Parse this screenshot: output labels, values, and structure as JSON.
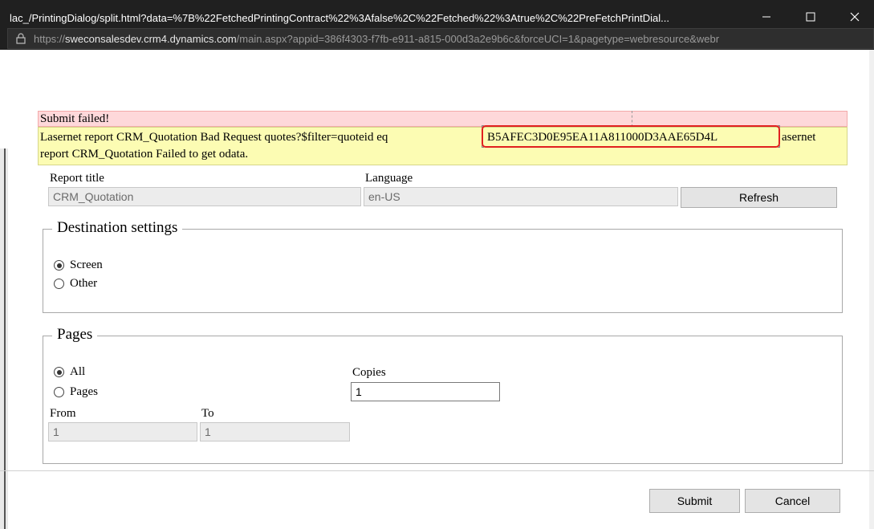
{
  "window": {
    "title": "lac_/PrintingDialog/split.html?data=%7B%22FetchedPrintingContract%22%3Afalse%2C%22Fetched%22%3Atrue%2C%22PreFetchPrintDial...",
    "url_scheme": "https://",
    "url_domain": "sweconsalesdev.crm4.dynamics.com",
    "url_rest": "/main.aspx?appid=386f4303-f7fb-e911-a815-000d3a2e9b6c&forceUCI=1&pagetype=webresource&webr"
  },
  "errors": {
    "submit_failed": "Submit failed!",
    "line1_prefix": "Lasernet report CRM_Quotation Bad Request quotes?$filter=quoteid eq",
    "line1_highlight": "B5AFEC3D0E95EA11A811000D3AAE65D4L",
    "line1_suffix": "asernet",
    "line2": "report CRM_Quotation Failed to get odata."
  },
  "report": {
    "title_label": "Report title",
    "title_value": "CRM_Quotation",
    "language_label": "Language",
    "language_value": "en-US",
    "refresh_label": "Refresh"
  },
  "destination": {
    "legend": "Destination settings",
    "options": [
      "Screen",
      "Other"
    ],
    "selected": "Screen"
  },
  "pages": {
    "legend": "Pages",
    "options": [
      "All",
      "Pages"
    ],
    "selected": "All",
    "copies_label": "Copies",
    "copies_value": "1",
    "from_label": "From",
    "from_value": "1",
    "to_label": "To",
    "to_value": "1"
  },
  "footer": {
    "submit_label": "Submit",
    "cancel_label": "Cancel"
  },
  "colors": {
    "error_bg": "#fed8da",
    "warning_bg": "#fcfcb3",
    "highlight_border": "#e02020",
    "titlebar_bg": "#202020"
  }
}
